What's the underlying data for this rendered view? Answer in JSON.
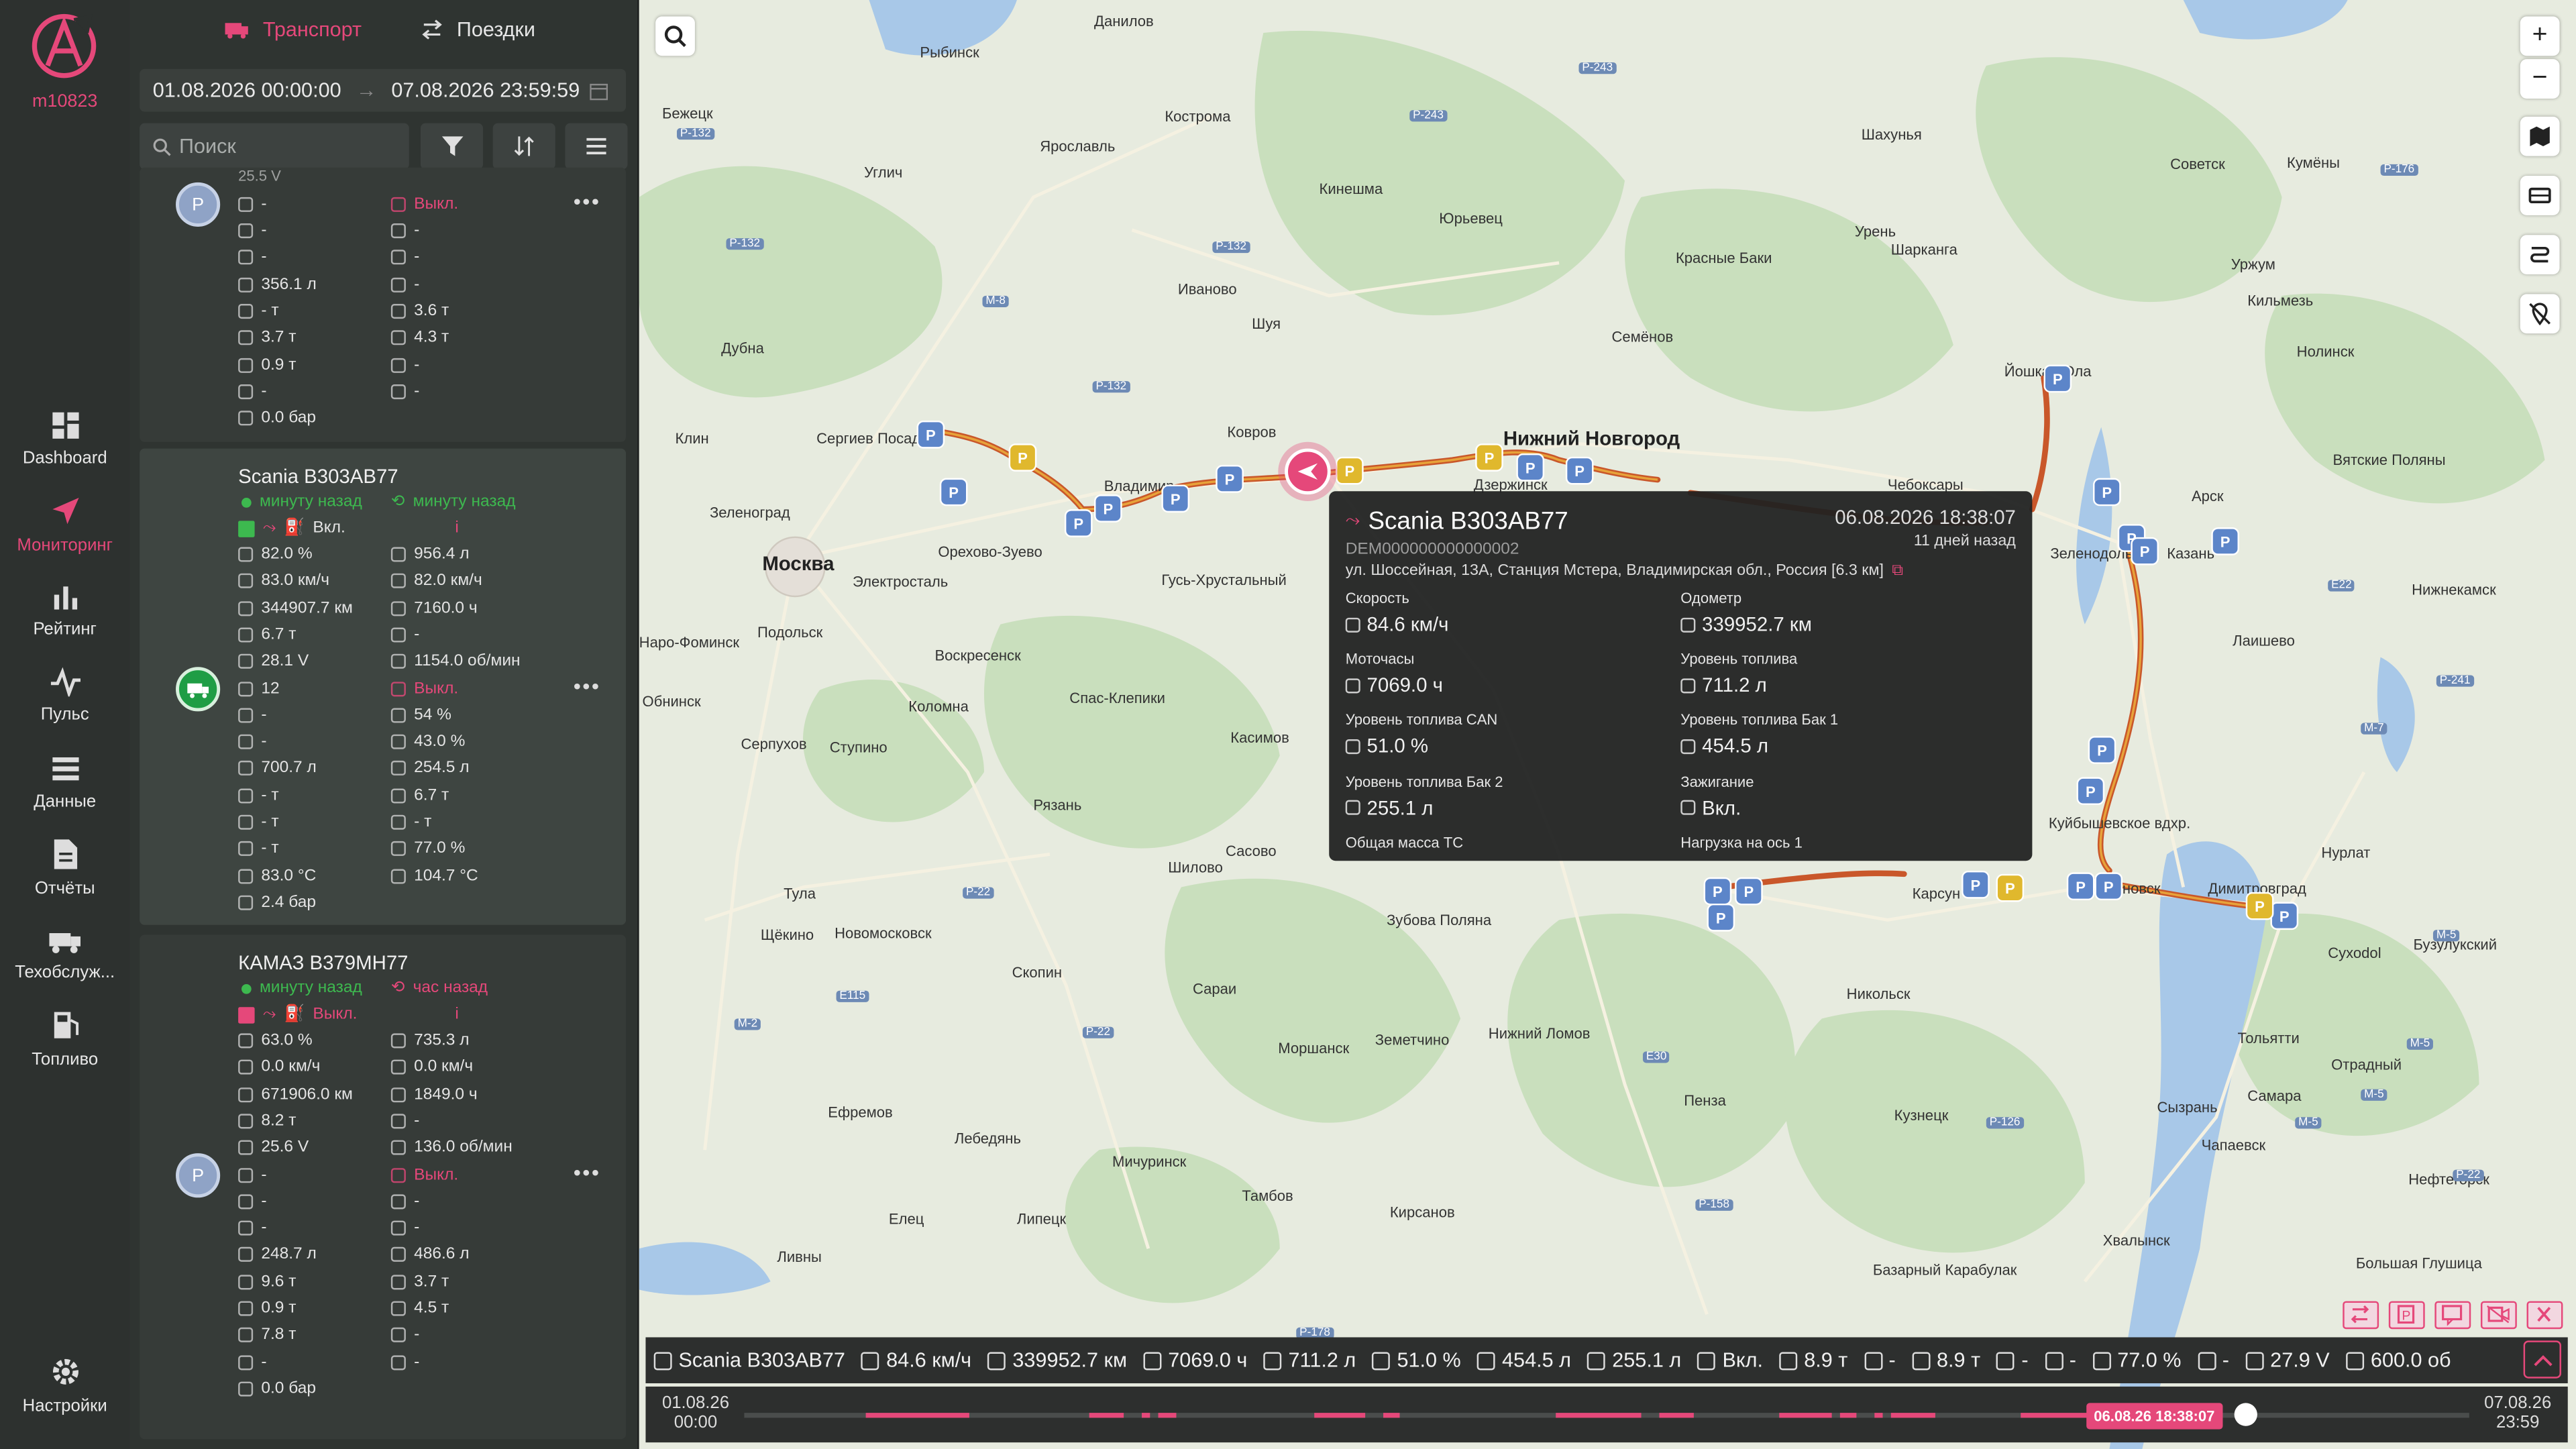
{
  "app": {
    "user": "m10823",
    "accent": "#e5487a"
  },
  "nav": [
    {
      "label": "Dashboard",
      "icon": "dashboard-icon"
    },
    {
      "label": "Мониторинг",
      "icon": "send-icon",
      "active": true
    },
    {
      "label": "Рейтинг",
      "icon": "bar-chart-icon"
    },
    {
      "label": "Пульс",
      "icon": "pulse-icon"
    },
    {
      "label": "Данные",
      "icon": "stack-icon"
    },
    {
      "label": "Отчёты",
      "icon": "document-icon"
    },
    {
      "label": "Техобслуж...",
      "icon": "service-truck-icon"
    },
    {
      "label": "Топливо",
      "icon": "fuel-icon"
    },
    {
      "label": "Настройки",
      "icon": "gear-icon"
    }
  ],
  "tabs": {
    "transport": "Транспорт",
    "trips": "Поездки"
  },
  "dates": {
    "from": "01.08.2026 00:00:00",
    "to": "07.08.2026 23:59:59"
  },
  "search": {
    "placeholder": "Поиск"
  },
  "card1": {
    "left": [
      "-",
      "-",
      "-",
      "356.1 л",
      "- т",
      "3.7 т",
      "0.9 т",
      "-",
      "0.0 бар"
    ],
    "right": [
      "Выкл.",
      "-",
      "-",
      "-",
      "3.6 т",
      "4.3 т",
      "-",
      "-"
    ],
    "top_partial": "25.5 V"
  },
  "card2": {
    "title": "Scania В303АВ77",
    "seen1": "минуту назад",
    "seen2": "минуту назад",
    "ign": "Вкл.",
    "left": [
      "82.0 %",
      "83.0 км/ч",
      "344907.7 км",
      "6.7 т",
      "28.1 V",
      "12",
      "-",
      "-",
      "700.7 л",
      "- т",
      "- т",
      "- т",
      "83.0 °C",
      "2.4 бар"
    ],
    "right": [
      "956.4 л",
      "82.0 км/ч",
      "7160.0 ч",
      "-",
      "1154.0 об/мин",
      "Выкл.",
      "54 %",
      "43.0 %",
      "254.5 л",
      "6.7 т",
      "- т",
      "77.0 %",
      "104.7 °C"
    ]
  },
  "card3": {
    "title": "КАМАЗ В379МН77",
    "seen1": "минуту назад",
    "seen2": "час назад",
    "ign": "Выкл.",
    "left": [
      "63.0 %",
      "0.0 км/ч",
      "671906.0 км",
      "8.2 т",
      "25.6 V",
      "-",
      "-",
      "-",
      "248.7 л",
      "9.6 т",
      "0.9 т",
      "7.8 т",
      "-",
      "0.0 бар"
    ],
    "right": [
      "735.3 л",
      "0.0 км/ч",
      "1849.0 ч",
      "-",
      "136.0 об/мин",
      "Выкл.",
      "-",
      "-",
      "486.6 л",
      "3.7 т",
      "4.5 т",
      "-",
      "-"
    ]
  },
  "popup": {
    "title": "Scania В303АВ77",
    "datetime": "06.08.2026 18:38:07",
    "device": "DEM000000000000002",
    "ago": "11 дней назад",
    "address": "ул. Шоссейная, 13А, Станция Мстера, Владимирская обл., Россия [6.3 км]",
    "fields": [
      {
        "label": "Скорость",
        "value": "84.6 км/ч"
      },
      {
        "label": "Одометр",
        "value": "339952.7 км"
      },
      {
        "label": "Моточасы",
        "value": "7069.0 ч"
      },
      {
        "label": "Уровень топлива",
        "value": "711.2 л"
      },
      {
        "label": "Уровень топлива CAN",
        "value": "51.0 %"
      },
      {
        "label": "Уровень топлива Бак 1",
        "value": "454.5 л"
      },
      {
        "label": "Уровень топлива Бак 2",
        "value": "255.1 л"
      },
      {
        "label": "Зажигание",
        "value": "Вкл."
      },
      {
        "label": "Общая масса ТС",
        "value": ""
      },
      {
        "label": "Нагрузка на ось 1",
        "value": ""
      }
    ]
  },
  "bottom": [
    "Scania В303АВ77",
    "84.6 км/ч",
    "339952.7 км",
    "7069.0 ч",
    "711.2 л",
    "51.0 %",
    "454.5 л",
    "255.1 л",
    "Вкл.",
    "8.9 т",
    "-",
    "8.9 т",
    "-",
    "-",
    "77.0 %",
    "-",
    "27.9 V",
    "600.0 об"
  ],
  "timeline": {
    "start_date": "01.08.26",
    "start_time": "00:00",
    "end_date": "07.08.26",
    "end_time": "23:59",
    "current": "06.08.26 18:38:07",
    "position": 0.87
  },
  "cities": [
    {
      "n": "Данилов"
    },
    {
      "n": "Рыбинск"
    },
    {
      "n": "Кострома"
    },
    {
      "n": "Ярославль"
    },
    {
      "n": "Углич"
    },
    {
      "n": "Бежецк"
    },
    {
      "n": "Иваново"
    },
    {
      "n": "Шуя"
    },
    {
      "n": "Кинешма"
    },
    {
      "n": "Юрьевец"
    },
    {
      "n": "Ковров"
    },
    {
      "n": "Владимир"
    },
    {
      "n": "Сергиев Посад"
    },
    {
      "n": "Клин"
    },
    {
      "n": "Дубна"
    },
    {
      "n": "Зеленоград"
    },
    {
      "n": "Москва"
    },
    {
      "n": "Электросталь"
    },
    {
      "n": "Орехово-Зуево"
    },
    {
      "n": "Подольск"
    },
    {
      "n": "Наро-Фоминск"
    },
    {
      "n": "Воскресенск"
    },
    {
      "n": "Обнинск"
    },
    {
      "n": "Коломна"
    },
    {
      "n": "Серпухов"
    },
    {
      "n": "Ступино"
    },
    {
      "n": "Спас-Клепики"
    },
    {
      "n": "Касимов"
    },
    {
      "n": "Рязань"
    },
    {
      "n": "Тула"
    },
    {
      "n": "Щёкино"
    },
    {
      "n": "Новомосковск"
    },
    {
      "n": "Скопин"
    },
    {
      "n": "Шилово"
    },
    {
      "n": "Сасово"
    },
    {
      "n": "Зубова Поляна"
    },
    {
      "n": "Сараи"
    },
    {
      "n": "Моршанск"
    },
    {
      "n": "Земетчино"
    },
    {
      "n": "Нижний Ломов"
    },
    {
      "n": "Пенза"
    },
    {
      "n": "Ефремов"
    },
    {
      "n": "Лебедянь"
    },
    {
      "n": "Мичуринск"
    },
    {
      "n": "Тамбов"
    },
    {
      "n": "Липецк"
    },
    {
      "n": "Елец"
    },
    {
      "n": "Ливны"
    },
    {
      "n": "Кирсанов"
    },
    {
      "n": "Нижний Новгород"
    },
    {
      "n": "Дзержинск"
    },
    {
      "n": "Семёнов"
    },
    {
      "n": "Красные Баки"
    },
    {
      "n": "Шахунья"
    },
    {
      "n": "Урень"
    },
    {
      "n": "Шарканга"
    },
    {
      "n": "Чебоксары"
    },
    {
      "n": "Йошкар-Ола"
    },
    {
      "n": "Советск"
    },
    {
      "n": "Уржум"
    },
    {
      "n": "Кильмезь"
    },
    {
      "n": "Кумёны"
    },
    {
      "n": "Нолинск"
    },
    {
      "n": "Арск"
    },
    {
      "n": "Вятские Поляны"
    },
    {
      "n": "Зеленодольск"
    },
    {
      "n": "Казань"
    },
    {
      "n": "Лаишево"
    },
    {
      "n": "Нижнекамск"
    },
    {
      "n": "Нурлат"
    },
    {
      "n": "Сухоdol"
    },
    {
      "n": "Тольятти"
    },
    {
      "n": "Самара"
    },
    {
      "n": "Сызрань"
    },
    {
      "n": "Кузнецк"
    },
    {
      "n": "Никольск"
    },
    {
      "n": "Карсун"
    },
    {
      "n": "Ульяновск"
    },
    {
      "n": "Димитровград"
    },
    {
      "n": "Отрадный"
    },
    {
      "n": "Нефтегорск"
    },
    {
      "n": "Чапаевск"
    },
    {
      "n": "Хвалынск"
    },
    {
      "n": "Базарный Карабулак"
    },
    {
      "n": "Большая Глушица"
    },
    {
      "n": "Гусь-Хрустальный"
    },
    {
      "n": "Куйбышевское вдхр."
    },
    {
      "n": "Бузулукский"
    }
  ],
  "roads": [
    "Р-243",
    "Р-243",
    "Р-176",
    "Р-132",
    "Р-132",
    "Р-132",
    "М-8",
    "Р-132",
    "Е22",
    "Р-241",
    "М-7",
    "Р-22",
    "Е115",
    "М-2",
    "Р-22",
    "Р-158",
    "М-5",
    "М-5",
    "М-5",
    "М-5",
    "Е30",
    "Р-126",
    "Р-22",
    "Р-178"
  ]
}
